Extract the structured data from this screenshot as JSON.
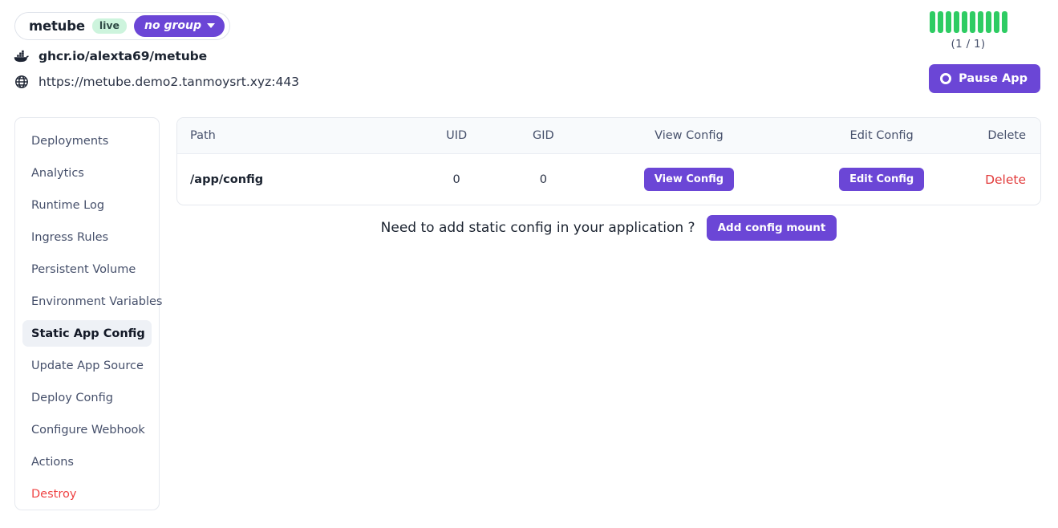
{
  "header": {
    "app_name": "metube",
    "status_badge": "live",
    "group_label": "no group",
    "image_icon": "docker-icon",
    "image": "ghcr.io/alexta69/metube",
    "url_icon": "globe-icon",
    "url": "https://metube.demo2.tanmoysrt.xyz:443"
  },
  "status": {
    "bar_count": 10,
    "bar_color": "#2ecc63",
    "count_label": "(1 / 1)",
    "pause_label": "Pause App",
    "pause_icon": "record-circle-icon"
  },
  "sidebar": {
    "items": [
      {
        "label": "Deployments",
        "active": false,
        "danger": false
      },
      {
        "label": "Analytics",
        "active": false,
        "danger": false
      },
      {
        "label": "Runtime Log",
        "active": false,
        "danger": false
      },
      {
        "label": "Ingress Rules",
        "active": false,
        "danger": false
      },
      {
        "label": "Persistent Volume",
        "active": false,
        "danger": false
      },
      {
        "label": "Environment Variables",
        "active": false,
        "danger": false
      },
      {
        "label": "Static App Config",
        "active": true,
        "danger": false
      },
      {
        "label": "Update App Source",
        "active": false,
        "danger": false
      },
      {
        "label": "Deploy Config",
        "active": false,
        "danger": false
      },
      {
        "label": "Configure Webhook",
        "active": false,
        "danger": false
      },
      {
        "label": "Actions",
        "active": false,
        "danger": false
      },
      {
        "label": "Destroy",
        "active": false,
        "danger": true
      }
    ]
  },
  "table": {
    "columns": [
      "Path",
      "UID",
      "GID",
      "View Config",
      "Edit Config",
      "Delete"
    ],
    "rows": [
      {
        "path": "/app/config",
        "uid": "0",
        "gid": "0",
        "view_label": "View Config",
        "edit_label": "Edit Config",
        "delete_label": "Delete"
      }
    ]
  },
  "cta": {
    "text": "Need to add static config in your application ?",
    "button_label": "Add config mount"
  },
  "colors": {
    "accent": "#6b46d6",
    "danger": "#e23b3b",
    "success": "#2ecc63",
    "badge_bg": "#cdf4dd"
  }
}
